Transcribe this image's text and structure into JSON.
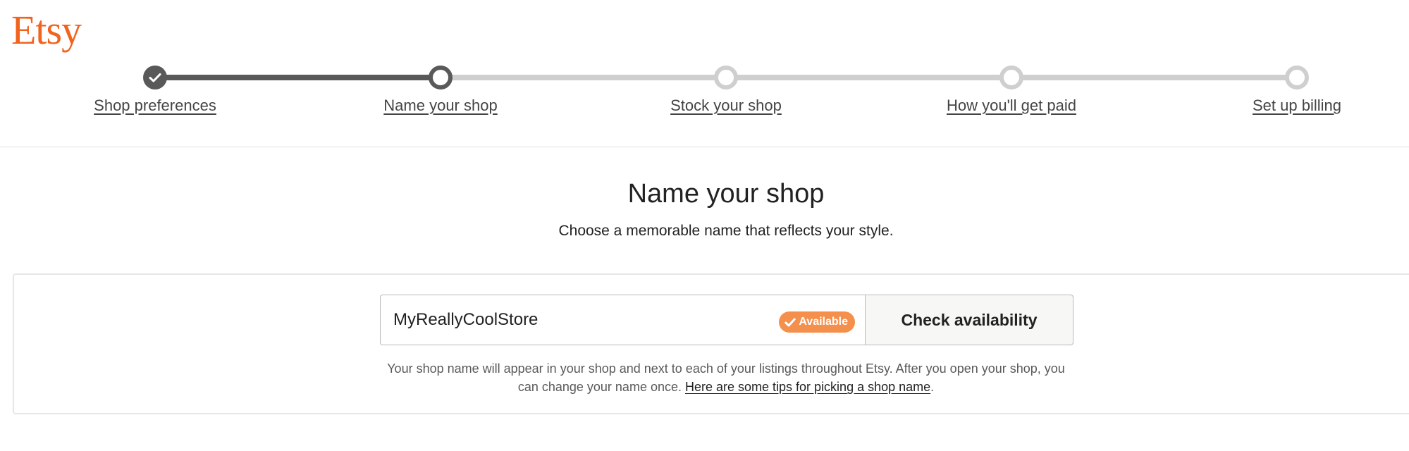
{
  "brand": {
    "logo_text": "Etsy"
  },
  "stepper": {
    "steps": [
      {
        "label": "Shop preferences",
        "state": "done"
      },
      {
        "label": "Name your shop",
        "state": "current"
      },
      {
        "label": "Stock your shop",
        "state": "todo"
      },
      {
        "label": "How you'll get paid",
        "state": "todo"
      },
      {
        "label": "Set up billing",
        "state": "todo"
      }
    ]
  },
  "main": {
    "title": "Name your shop",
    "subtitle": "Choose a memorable name that reflects your style.",
    "shop_name_value": "MyReallyCoolStore",
    "availability_badge": "Available",
    "check_button_label": "Check availability",
    "help_text_before": "Your shop name will appear in your shop and next to each of your listings throughout Etsy. After you open your shop, you can change your name once. ",
    "help_link": "Here are some tips for picking a shop name",
    "help_text_after": "."
  },
  "icons": {
    "step_done": "check-icon",
    "badge": "check-icon"
  },
  "colors": {
    "brand_orange": "#F1641E",
    "step_dark": "#595959",
    "step_light": "#CFCFCF",
    "badge_bg": "#F58F4C",
    "button_bg": "#F7F7F5",
    "divider": "#E1E1E1",
    "label_text": "#444444",
    "help_text": "#595959",
    "link_text": "#222222"
  }
}
